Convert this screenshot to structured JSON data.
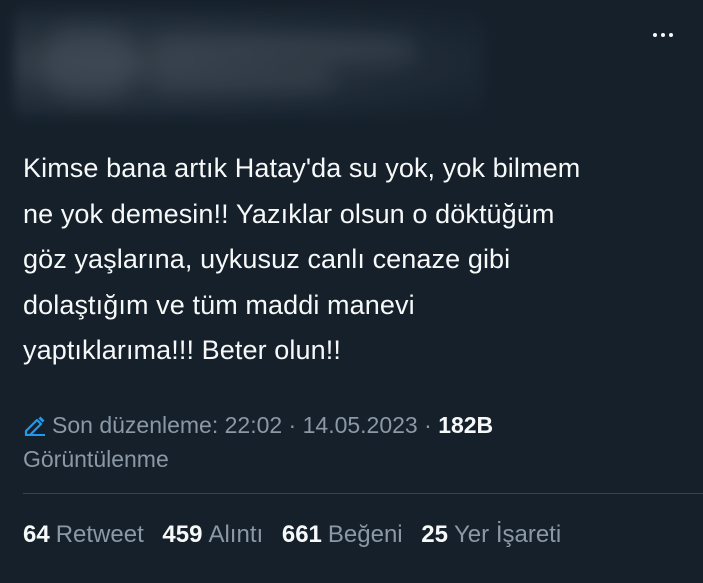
{
  "tweet": {
    "text": "Kimse bana artık Hatay'da su yok, yok bilmem\nne yok demesin!! Yazıklar olsun o döktüğüm\ngöz yaşlarına, uykusuz canlı cenaze gibi\ndolaştığım ve tüm maddi manevi\nyaptıklarıma!!! Beter olun!!",
    "edited_label": "Son düzenleme: 22:02 · 14.05.2023",
    "separator": " · ",
    "views_count": "182B",
    "views_label": "Görüntülenme"
  },
  "stats": [
    {
      "count": "64",
      "label": "Retweet"
    },
    {
      "count": "459",
      "label": "Alıntı"
    },
    {
      "count": "661",
      "label": "Beğeni"
    },
    {
      "count": "25",
      "label": "Yer İşareti"
    }
  ],
  "icons": {
    "more": "more-horizontal-icon",
    "edit": "pencil-icon"
  },
  "colors": {
    "background": "#15202b",
    "text_primary": "#f7f9f9",
    "text_secondary": "#8b98a5",
    "accent": "#1d9bf0",
    "divider": "#38444d"
  }
}
